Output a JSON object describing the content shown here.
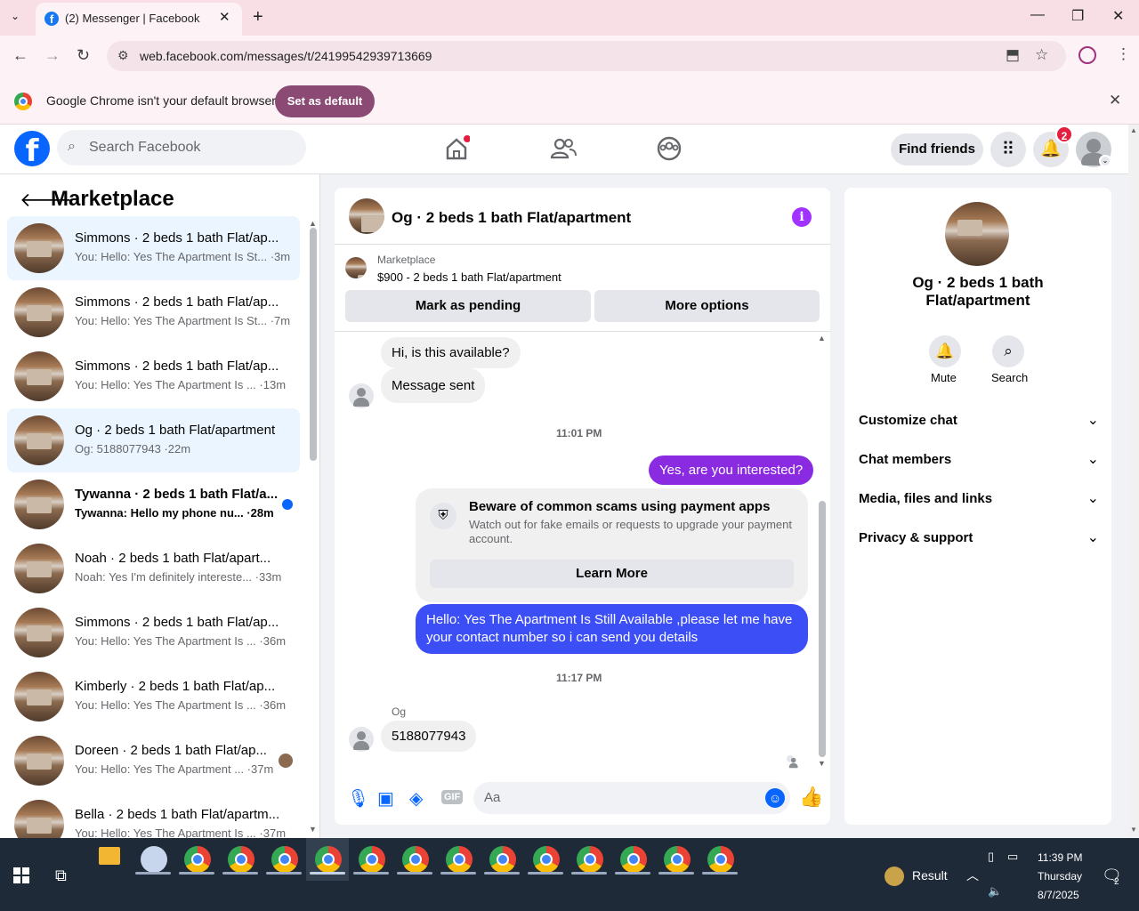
{
  "browser": {
    "tab_title": "(2) Messenger | Facebook",
    "url": "web.facebook.com/messages/t/24199542939713669",
    "infobar_text": "Google Chrome isn't your default browser",
    "infobar_button": "Set as default"
  },
  "fb": {
    "search_placeholder": "Search Facebook",
    "find_friends": "Find friends",
    "notif_count": "2"
  },
  "sidebar": {
    "title": "Marketplace",
    "conversations": [
      {
        "name": "Simmons · 2 beds 1 bath Flat/ap...",
        "preview": "You: Hello: Yes The Apartment Is St... ·3m"
      },
      {
        "name": "Simmons · 2 beds 1 bath Flat/ap...",
        "preview": "You: Hello: Yes The Apartment Is St... ·7m"
      },
      {
        "name": "Simmons · 2 beds 1 bath Flat/ap...",
        "preview": "You: Hello: Yes The Apartment Is ... ·13m"
      },
      {
        "name": "Og · 2 beds 1 bath Flat/apartment",
        "preview": "Og: 5188077943 ·22m"
      },
      {
        "name": "Tywanna · 2 beds 1 bath Flat/a...",
        "preview": "Tywanna: Hello my phone nu... ·28m"
      },
      {
        "name": "Noah · 2 beds 1 bath Flat/apart...",
        "preview": "Noah: Yes I'm definitely intereste... ·33m"
      },
      {
        "name": "Simmons · 2 beds 1 bath Flat/ap...",
        "preview": "You: Hello: Yes The Apartment Is ... ·36m"
      },
      {
        "name": "Kimberly · 2 beds 1 bath Flat/ap...",
        "preview": "You: Hello: Yes The Apartment Is ... ·36m"
      },
      {
        "name": "Doreen · 2 beds 1 bath Flat/ap...",
        "preview": "You: Hello: Yes The Apartment ... ·37m"
      },
      {
        "name": "Bella · 2 beds 1 bath Flat/apartm...",
        "preview": "You: Hello: Yes The Apartment Is ... ·37m"
      }
    ]
  },
  "chat": {
    "title": "Og · 2 beds 1 bath Flat/apartment",
    "listing_label": "Marketplace",
    "listing_price": "$900 - 2 beds 1 bath Flat/apartment",
    "mark_pending": "Mark as pending",
    "more_options": "More options",
    "msg_in_1": "Hi, is this available?",
    "msg_in_2": "Message sent",
    "time_1": "11:01 PM",
    "msg_out_1": "Yes, are you interested?",
    "scam_title": "Beware of common scams using payment apps",
    "scam_body": "Watch out for fake emails or requests to upgrade your payment account.",
    "learn_more": "Learn More",
    "msg_out_2": "Hello: Yes The Apartment Is Still Available ,please let me have your contact number so i can send you details",
    "time_2": "11:17 PM",
    "sender_name": "Og",
    "msg_in_3": "5188077943",
    "composer_placeholder": "Aa"
  },
  "details": {
    "name": "Og · 2 beds 1 bath Flat/apartment",
    "mute": "Mute",
    "search": "Search",
    "sections": [
      "Customize chat",
      "Chat members",
      "Media, files and links",
      "Privacy & support"
    ]
  },
  "taskbar": {
    "result": "Result",
    "time": "11:39 PM",
    "day": "Thursday",
    "date": "8/7/2025",
    "notif": "2"
  }
}
